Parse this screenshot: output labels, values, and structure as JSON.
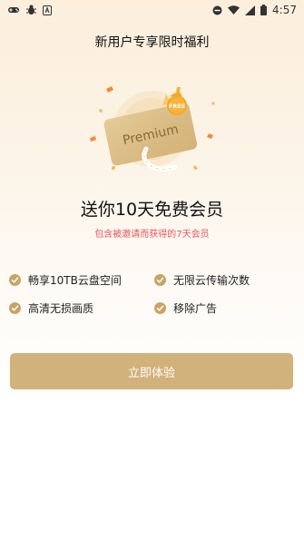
{
  "status_bar": {
    "time": "4:57",
    "left_icons": [
      "gamepad-icon",
      "bug-icon",
      "app-icon"
    ],
    "right_icons": [
      "dnd-icon",
      "wifi-icon",
      "signal-icon",
      "battery-icon"
    ]
  },
  "page": {
    "title": "新用户专享限时福利"
  },
  "illustration": {
    "card_text": "Premium",
    "badge_text": "FREE",
    "colors": {
      "card": "#ddc08c",
      "badge": "#f6a623",
      "confetti": "#f08a3a"
    }
  },
  "offer": {
    "headline": "送你10天免费会员",
    "subline": "包含被邀请而获得的7天会员"
  },
  "benefits": [
    {
      "label": "畅享10TB云盘空间"
    },
    {
      "label": "无限云传输次数"
    },
    {
      "label": "高清无损画质"
    },
    {
      "label": "移除广告"
    }
  ],
  "cta": {
    "label": "立即体验"
  },
  "colors": {
    "accent": "#d1b27b",
    "check": "#c8a465",
    "subline": "#e9545b"
  }
}
